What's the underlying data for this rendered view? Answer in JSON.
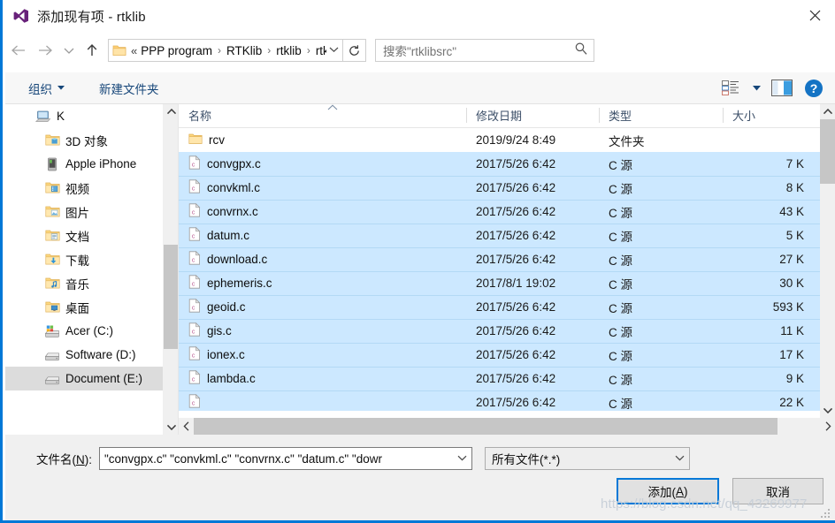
{
  "window": {
    "title": "添加现有项 - rtklib",
    "app_icon": "visual-studio-icon",
    "close_label": "✕",
    "accent_color": "#0078d7"
  },
  "nav": {
    "back_label": "←",
    "forward_label": "→",
    "recent_label": "⌄",
    "up_label": "↑",
    "address": {
      "folder_icon": "folder-icon",
      "lead": "«",
      "crumbs": [
        "PPP program",
        "RTKlib",
        "rtklib",
        "rtklib",
        "rtklibsrc"
      ],
      "separator": "›",
      "dropdown_label": "⌄"
    },
    "refresh_label": "↻",
    "search": {
      "placeholder": "搜索\"rtklibsrc\"",
      "icon": "search-icon"
    }
  },
  "toolbar": {
    "organize_label": "组织",
    "organize_caret": "▼",
    "new_folder_label": "新建文件夹",
    "view_icon": "view-list-icon",
    "view_caret": "▼",
    "preview_icon": "preview-pane-icon",
    "help_icon": "help-icon",
    "help_glyph": "?"
  },
  "sidebar": {
    "items": [
      {
        "label": "K",
        "icon": "computer-icon",
        "indent": 0,
        "selected": false
      },
      {
        "label": "3D 对象",
        "icon": "folder-3d-icon",
        "indent": 1,
        "selected": false
      },
      {
        "label": "Apple iPhone",
        "icon": "phone-icon",
        "indent": 1,
        "selected": false
      },
      {
        "label": "视频",
        "icon": "folder-video-icon",
        "indent": 1,
        "selected": false
      },
      {
        "label": "图片",
        "icon": "folder-pictures-icon",
        "indent": 1,
        "selected": false
      },
      {
        "label": "文档",
        "icon": "folder-documents-icon",
        "indent": 1,
        "selected": false
      },
      {
        "label": "下载",
        "icon": "folder-downloads-icon",
        "indent": 1,
        "selected": false
      },
      {
        "label": "音乐",
        "icon": "folder-music-icon",
        "indent": 1,
        "selected": false
      },
      {
        "label": "桌面",
        "icon": "folder-desktop-icon",
        "indent": 1,
        "selected": false
      },
      {
        "label": "Acer (C:)",
        "icon": "drive-windows-icon",
        "indent": 1,
        "selected": false
      },
      {
        "label": "Software (D:)",
        "icon": "drive-icon",
        "indent": 1,
        "selected": false
      },
      {
        "label": "Document (E:)",
        "icon": "drive-icon",
        "indent": 1,
        "selected": true
      }
    ],
    "scroll_up": "⌃",
    "scroll_down": "⌄"
  },
  "filelist": {
    "columns": {
      "name": "名称",
      "date": "修改日期",
      "type": "类型",
      "size": "大小"
    },
    "sort_marker": "⌃",
    "rows": [
      {
        "name": "rcv",
        "date": "2019/9/24 8:49",
        "type": "文件夹",
        "size": "",
        "icon": "folder-icon",
        "selected": false
      },
      {
        "name": "convgpx.c",
        "date": "2017/5/26 6:42",
        "type": "C 源",
        "size": "7 K",
        "icon": "c-source-icon",
        "selected": true
      },
      {
        "name": "convkml.c",
        "date": "2017/5/26 6:42",
        "type": "C 源",
        "size": "8 K",
        "icon": "c-source-icon",
        "selected": true
      },
      {
        "name": "convrnx.c",
        "date": "2017/5/26 6:42",
        "type": "C 源",
        "size": "43 K",
        "icon": "c-source-icon",
        "selected": true
      },
      {
        "name": "datum.c",
        "date": "2017/5/26 6:42",
        "type": "C 源",
        "size": "5 K",
        "icon": "c-source-icon",
        "selected": true
      },
      {
        "name": "download.c",
        "date": "2017/5/26 6:42",
        "type": "C 源",
        "size": "27 K",
        "icon": "c-source-icon",
        "selected": true
      },
      {
        "name": "ephemeris.c",
        "date": "2017/8/1 19:02",
        "type": "C 源",
        "size": "30 K",
        "icon": "c-source-icon",
        "selected": true
      },
      {
        "name": "geoid.c",
        "date": "2017/5/26 6:42",
        "type": "C 源",
        "size": "593 K",
        "icon": "c-source-icon",
        "selected": true
      },
      {
        "name": "gis.c",
        "date": "2017/5/26 6:42",
        "type": "C 源",
        "size": "11 K",
        "icon": "c-source-icon",
        "selected": true
      },
      {
        "name": "ionex.c",
        "date": "2017/5/26 6:42",
        "type": "C 源",
        "size": "17 K",
        "icon": "c-source-icon",
        "selected": true
      },
      {
        "name": "lambda.c",
        "date": "2017/5/26 6:42",
        "type": "C 源",
        "size": "9 K",
        "icon": "c-source-icon",
        "selected": true
      },
      {
        "name": "",
        "date": "2017/5/26 6:42",
        "type": "C 源",
        "size": "22 K",
        "icon": "c-source-icon",
        "selected": true
      }
    ],
    "hscroll_left": "‹",
    "hscroll_right": "›"
  },
  "footer": {
    "filename_label_prefix": "文件名(",
    "filename_label_key": "N",
    "filename_label_suffix": "):",
    "filename_value": "\"convgpx.c\" \"convkml.c\" \"convrnx.c\" \"datum.c\" \"dowr",
    "filename_caret": "⌄",
    "filter_value": "所有文件(*.*)",
    "filter_caret": "⌄",
    "add_prefix": "添加(",
    "add_key": "A",
    "add_suffix": ")",
    "cancel_label": "取消"
  },
  "watermark": "https://blog.csdn.net/qq_43269977"
}
